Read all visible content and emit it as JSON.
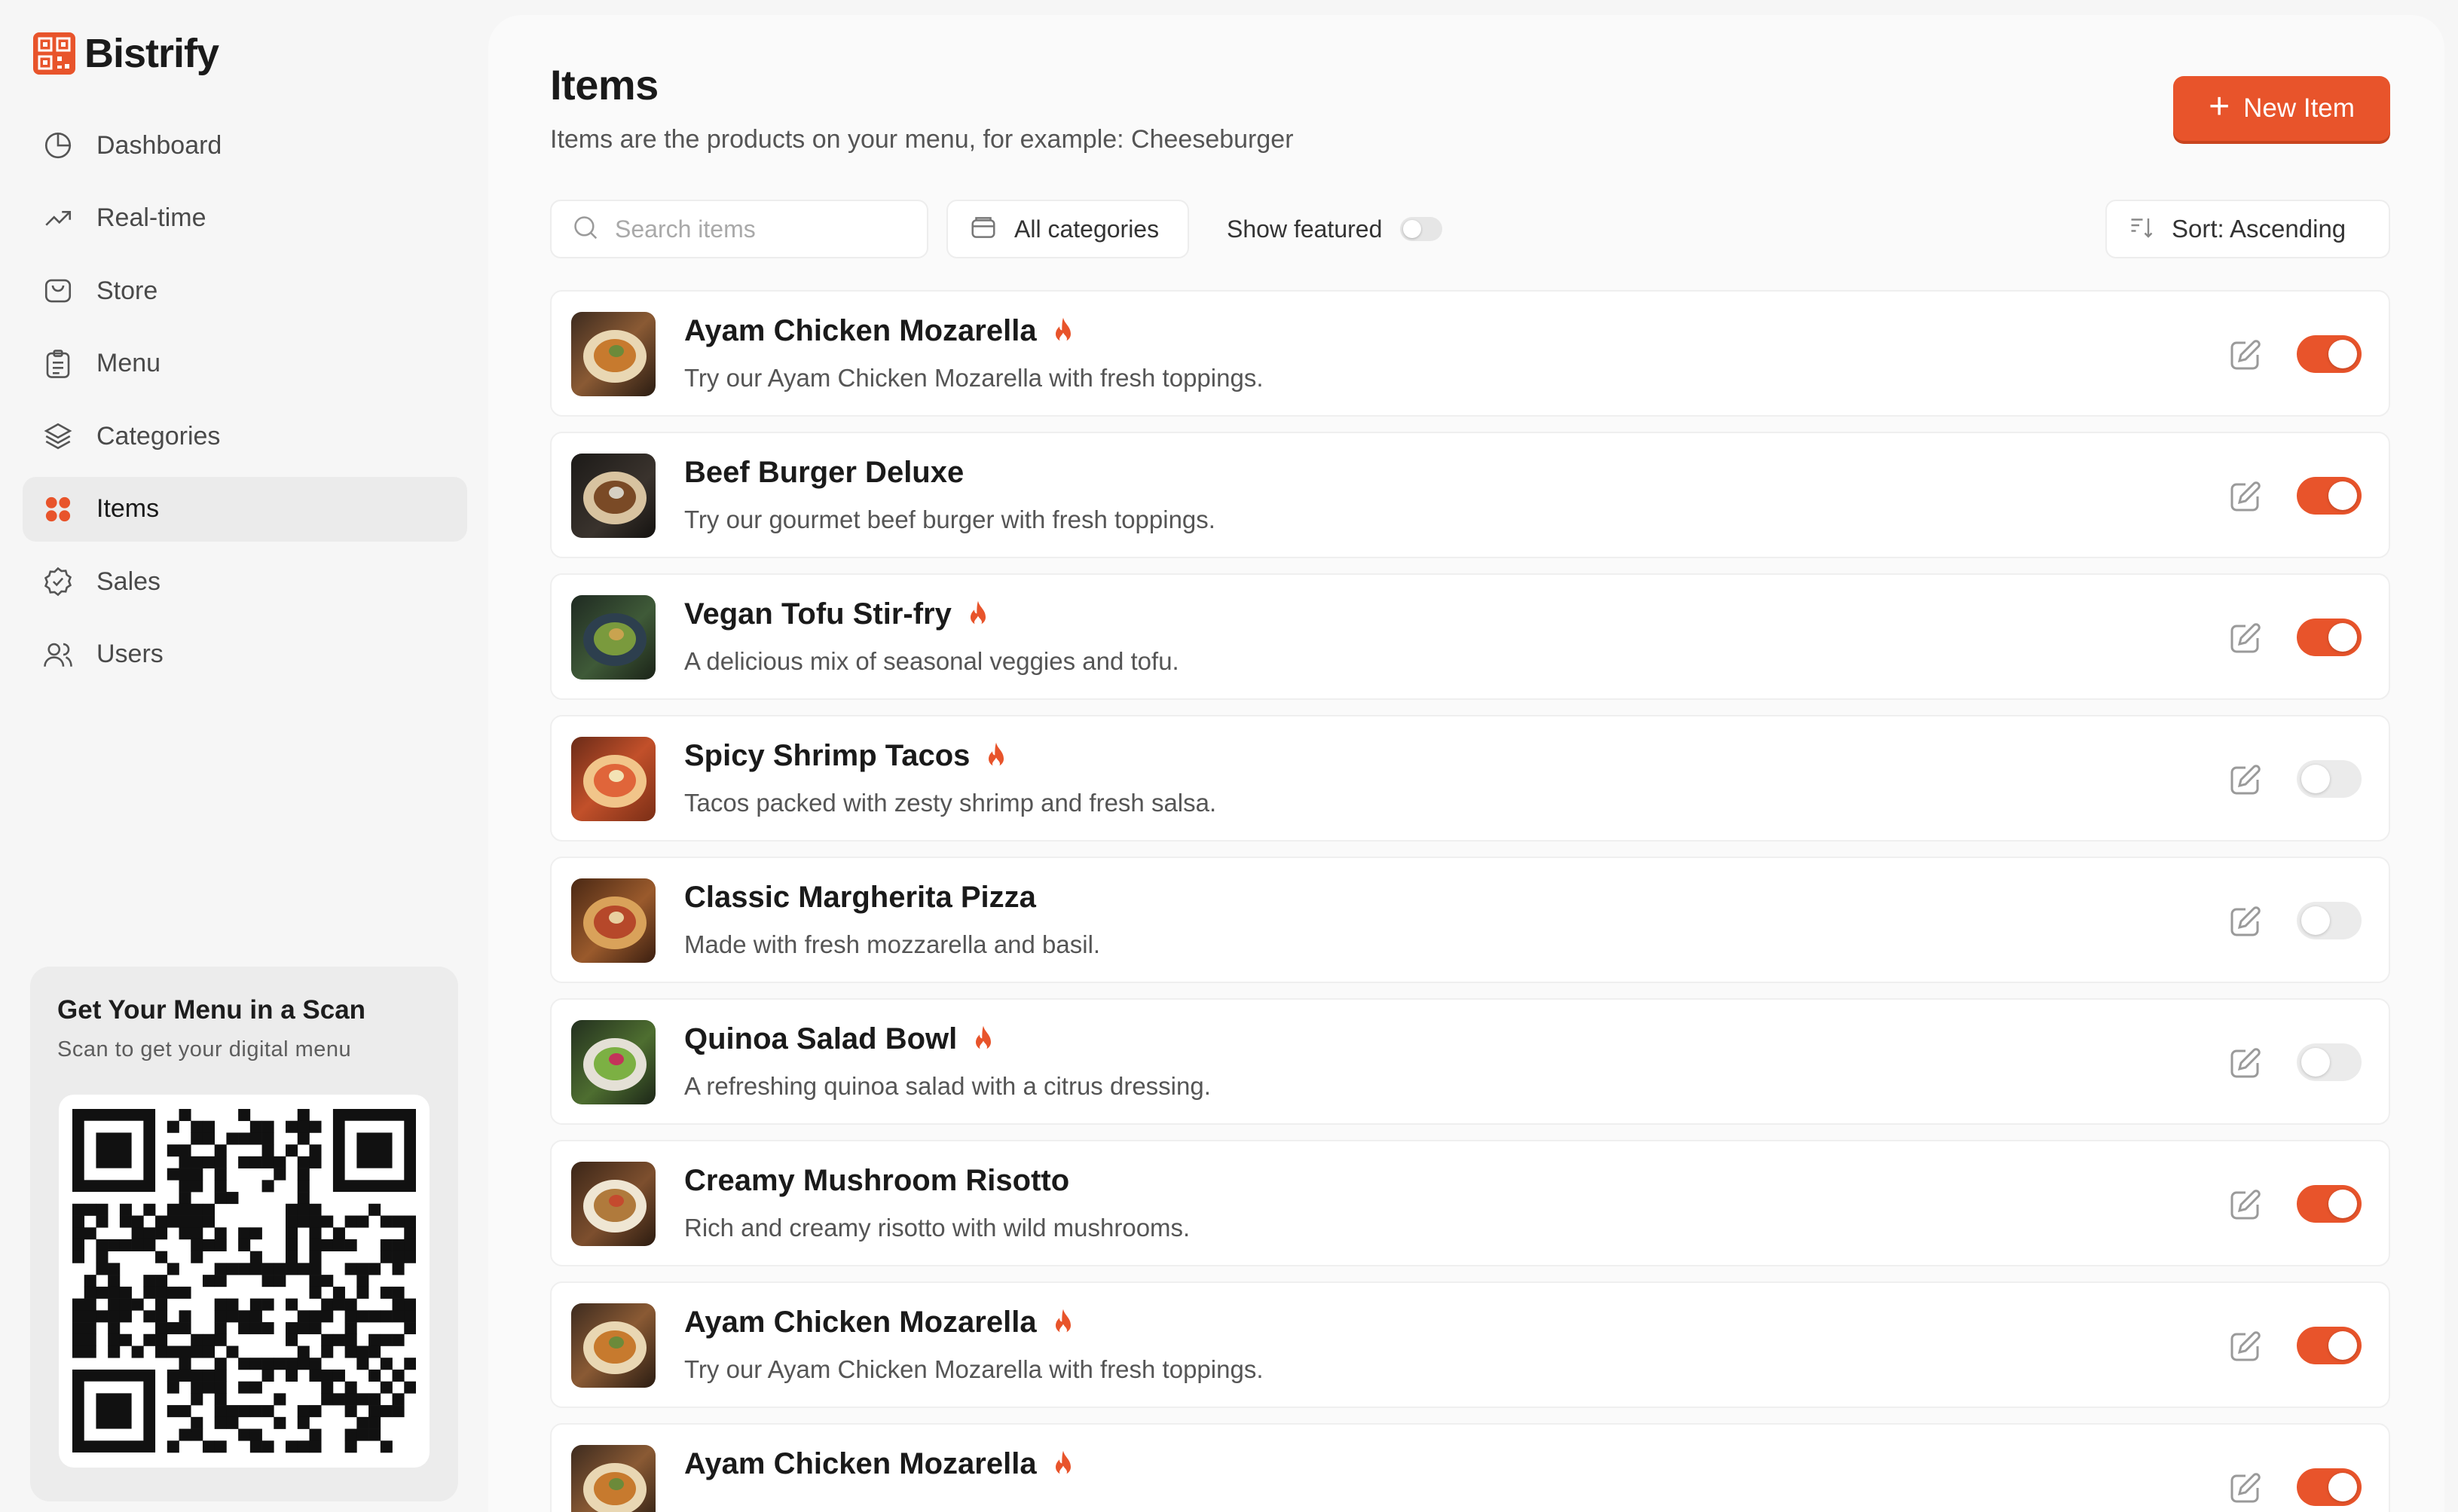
{
  "brand": {
    "name": "Bistrify",
    "accent": "#e8542b"
  },
  "nav": [
    {
      "label": "Dashboard",
      "icon": "pie-chart-icon",
      "active": false
    },
    {
      "label": "Real-time",
      "icon": "trend-up-icon",
      "active": false
    },
    {
      "label": "Store",
      "icon": "store-icon",
      "active": false
    },
    {
      "label": "Menu",
      "icon": "clipboard-icon",
      "active": false
    },
    {
      "label": "Categories",
      "icon": "layers-icon",
      "active": false
    },
    {
      "label": "Items",
      "icon": "grid-icon",
      "active": true
    },
    {
      "label": "Sales",
      "icon": "badge-check-icon",
      "active": false
    },
    {
      "label": "Users",
      "icon": "users-icon",
      "active": false
    }
  ],
  "qr_card": {
    "title": "Get Your Menu in a Scan",
    "subtitle": "Scan to get your digital menu"
  },
  "page": {
    "title": "Items",
    "subtitle": "Items are the products on your menu, for example: Cheeseburger",
    "new_button": "New Item"
  },
  "toolbar": {
    "search_placeholder": "Search items",
    "category_filter": "All categories",
    "featured_label": "Show featured",
    "featured_on": false,
    "sort_label": "Sort: Ascending"
  },
  "items": [
    {
      "name": "Ayam Chicken Mozarella",
      "description": "Try our Ayam Chicken Mozarella with fresh toppings.",
      "featured": true,
      "enabled": true,
      "image": "chicken-dish"
    },
    {
      "name": "Beef Burger Deluxe",
      "description": "Try our gourmet beef burger with fresh toppings.",
      "featured": false,
      "enabled": true,
      "image": "burger"
    },
    {
      "name": "Vegan Tofu Stir-fry",
      "description": "A delicious mix of seasonal veggies and tofu.",
      "featured": true,
      "enabled": true,
      "image": "stir-fry"
    },
    {
      "name": "Spicy Shrimp Tacos",
      "description": "Tacos packed with zesty shrimp and fresh salsa.",
      "featured": true,
      "enabled": false,
      "image": "tacos"
    },
    {
      "name": "Classic Margherita Pizza",
      "description": "Made with fresh mozzarella and basil.",
      "featured": false,
      "enabled": false,
      "image": "pizza"
    },
    {
      "name": "Quinoa Salad Bowl",
      "description": "A refreshing quinoa salad with a citrus dressing.",
      "featured": true,
      "enabled": false,
      "image": "salad"
    },
    {
      "name": "Creamy Mushroom Risotto",
      "description": "Rich and creamy risotto with wild mushrooms.",
      "featured": false,
      "enabled": true,
      "image": "risotto"
    },
    {
      "name": "Ayam Chicken Mozarella",
      "description": "Try our Ayam Chicken Mozarella with fresh toppings.",
      "featured": true,
      "enabled": true,
      "image": "chicken-dish"
    },
    {
      "name": "Ayam Chicken Mozarella",
      "description": "",
      "featured": true,
      "enabled": true,
      "image": "chicken-dish"
    }
  ]
}
